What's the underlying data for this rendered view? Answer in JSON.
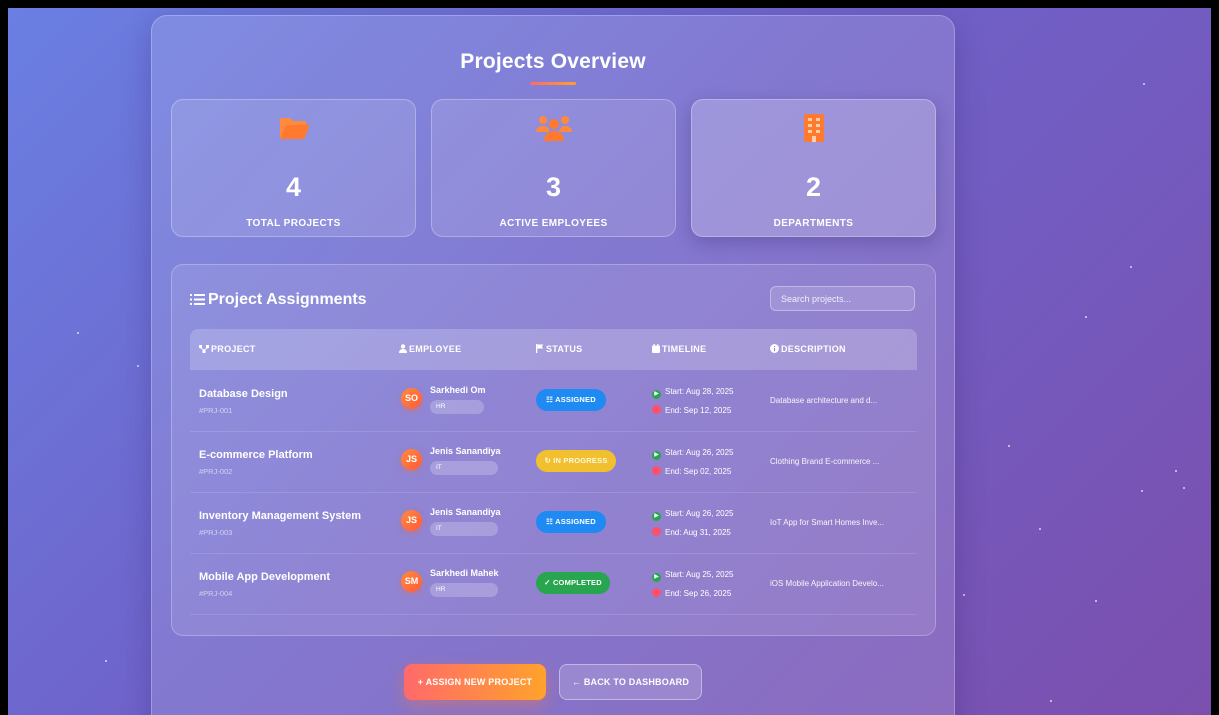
{
  "page": {
    "title": "Projects Overview"
  },
  "stats": [
    {
      "icon": "folder-open-icon",
      "value": "4",
      "label": "TOTAL PROJECTS"
    },
    {
      "icon": "users-icon",
      "value": "3",
      "label": "ACTIVE EMPLOYEES"
    },
    {
      "icon": "building-icon",
      "value": "2",
      "label": "DEPARTMENTS"
    }
  ],
  "assignments": {
    "title": "Project Assignments",
    "search_placeholder": "Search projects...",
    "columns": {
      "project": "PROJECT",
      "employee": "EMPLOYEE",
      "status": "STATUS",
      "timeline": "TIMELINE",
      "description": "DESCRIPTION"
    },
    "rows": [
      {
        "project": "Database Design",
        "id": "#PRJ-001",
        "initials": "SO",
        "employee": "Sarkhedi Om",
        "dept": "HR",
        "status": "ASSIGNED",
        "status_icon": "☷",
        "start": "Start: Aug 28, 2025",
        "end": "End: Sep 12, 2025",
        "description": "Database architecture and d..."
      },
      {
        "project": "E-commerce Platform",
        "id": "#PRJ-002",
        "initials": "JS",
        "employee": "Jenis Sanandiya",
        "dept": "IT",
        "status": "IN PROGRESS",
        "status_icon": "↻",
        "start": "Start: Aug 26, 2025",
        "end": "End: Sep 02, 2025",
        "description": "Clothing Brand E-commerce ..."
      },
      {
        "project": "Inventory Management System",
        "id": "#PRJ-003",
        "initials": "JS",
        "employee": "Jenis Sanandiya",
        "dept": "IT",
        "status": "ASSIGNED",
        "status_icon": "☷",
        "start": "Start: Aug 26, 2025",
        "end": "End: Aug 31, 2025",
        "description": "IoT App for Smart Homes Inve..."
      },
      {
        "project": "Mobile App Development",
        "id": "#PRJ-004",
        "initials": "SM",
        "employee": "Sarkhedi Mahek",
        "dept": "HR",
        "status": "COMPLETED",
        "status_icon": "✓",
        "start": "Start: Aug 25, 2025",
        "end": "End: Sep 26, 2025",
        "description": "iOS Mobile Application Develo..."
      }
    ]
  },
  "actions": {
    "assign_label": "+ ASSIGN NEW PROJECT",
    "back_label": "← BACK TO DASHBOARD"
  },
  "colors": {
    "accent_orange": "#ff8a3d",
    "assigned": "#1f8bf2",
    "in_progress": "#f0c02e",
    "completed": "#27a64f"
  }
}
